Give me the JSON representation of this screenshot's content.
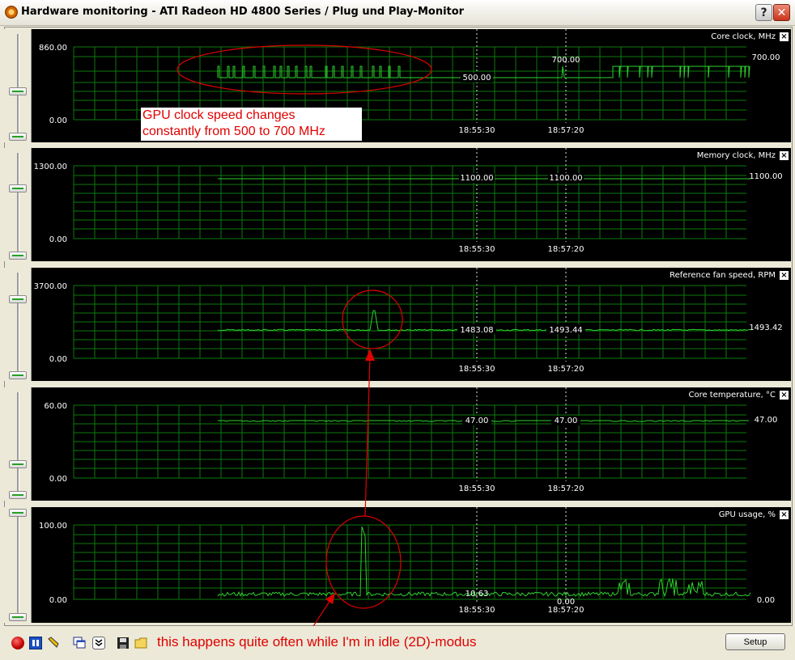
{
  "window": {
    "title": "Hardware monitoring - ATI Radeon HD 4800 Series / Plug und Play-Monitor",
    "help_label": "?",
    "close_label": "✕"
  },
  "time_markers": [
    "18:55:30",
    "18:57:20"
  ],
  "graphs": [
    {
      "name": "Core clock, MHz",
      "max_label": "860.00",
      "min_label": "0.00",
      "current_value": "700.00",
      "values_at_markers": [
        "500.00",
        "700.00"
      ]
    },
    {
      "name": "Memory clock, MHz",
      "max_label": "1300.00",
      "min_label": "0.00",
      "current_value": "1100.00",
      "values_at_markers": [
        "1100.00",
        "1100.00"
      ]
    },
    {
      "name": "Reference fan speed, RPM",
      "max_label": "3700.00",
      "min_label": "0.00",
      "current_value": "1493.42",
      "values_at_markers": [
        "1483.08",
        "1493.44"
      ]
    },
    {
      "name": "Core temperature, °C",
      "max_label": "60.00",
      "min_label": "0.00",
      "current_value": "47.00",
      "values_at_markers": [
        "47.00",
        "47.00"
      ]
    },
    {
      "name": "GPU usage, %",
      "max_label": "100.00",
      "min_label": "0.00",
      "current_value": "0.00",
      "values_at_markers": [
        "10.63",
        "0.00"
      ]
    }
  ],
  "annotations": {
    "top_line1": "GPU clock speed changes",
    "top_line2": "constantly from 500 to 700 MHz",
    "bottom": "this happens quite often while I'm in idle (2D)-modus"
  },
  "toolbar": {
    "icons": [
      "record-icon",
      "pause-icon",
      "pen-icon",
      "copy-window-icon",
      "collapse-icon",
      "save-icon",
      "folder-icon"
    ],
    "setup_label": "Setup"
  },
  "colors": {
    "graph_line": "#2cd22c",
    "grid": "#0b7a0b",
    "annotation": "#e00000"
  }
}
